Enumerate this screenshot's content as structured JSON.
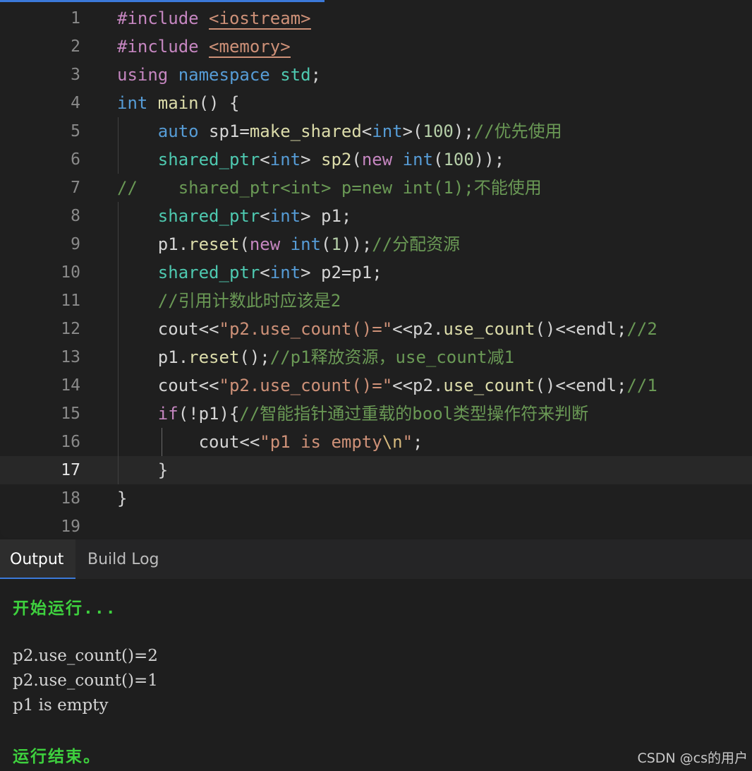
{
  "editor": {
    "active_line": "17",
    "lines": [
      {
        "n": "1",
        "tokens": [
          {
            "t": "#include ",
            "c": "pp"
          },
          {
            "t": "<iostream>",
            "c": "inc"
          }
        ]
      },
      {
        "n": "2",
        "tokens": [
          {
            "t": "#include ",
            "c": "pp"
          },
          {
            "t": "<memory>",
            "c": "inc"
          }
        ]
      },
      {
        "n": "3",
        "tokens": [
          {
            "t": "using ",
            "c": "ctl"
          },
          {
            "t": "namespace ",
            "c": "kw"
          },
          {
            "t": "std",
            "c": "ns"
          },
          {
            "t": ";",
            "c": ""
          }
        ]
      },
      {
        "n": "4",
        "tokens": [
          {
            "t": "int ",
            "c": "ty"
          },
          {
            "t": "main",
            "c": "fn"
          },
          {
            "t": "() {",
            "c": ""
          }
        ]
      },
      {
        "n": "5",
        "tokens": [
          {
            "t": "    ",
            "c": ""
          },
          {
            "t": "auto ",
            "c": "kw"
          },
          {
            "t": "sp1=",
            "c": ""
          },
          {
            "t": "make_shared",
            "c": "fn"
          },
          {
            "t": "<",
            "c": ""
          },
          {
            "t": "int",
            "c": "ty"
          },
          {
            "t": ">(",
            "c": ""
          },
          {
            "t": "100",
            "c": "num"
          },
          {
            "t": ");",
            "c": ""
          },
          {
            "t": "//优先使用",
            "c": "com"
          }
        ]
      },
      {
        "n": "6",
        "tokens": [
          {
            "t": "    ",
            "c": ""
          },
          {
            "t": "shared_ptr",
            "c": "ns"
          },
          {
            "t": "<",
            "c": ""
          },
          {
            "t": "int",
            "c": "ty"
          },
          {
            "t": "> ",
            "c": ""
          },
          {
            "t": "sp2",
            "c": "fn"
          },
          {
            "t": "(",
            "c": ""
          },
          {
            "t": "new ",
            "c": "ctl"
          },
          {
            "t": "int",
            "c": "ty"
          },
          {
            "t": "(",
            "c": ""
          },
          {
            "t": "100",
            "c": "num"
          },
          {
            "t": "));",
            "c": ""
          }
        ]
      },
      {
        "n": "7",
        "tokens": [
          {
            "t": "//    shared_ptr<int> p=new int(1);不能使用",
            "c": "com"
          }
        ]
      },
      {
        "n": "8",
        "tokens": [
          {
            "t": "    ",
            "c": ""
          },
          {
            "t": "shared_ptr",
            "c": "ns"
          },
          {
            "t": "<",
            "c": ""
          },
          {
            "t": "int",
            "c": "ty"
          },
          {
            "t": "> p1;",
            "c": ""
          }
        ]
      },
      {
        "n": "9",
        "tokens": [
          {
            "t": "    p1.",
            "c": ""
          },
          {
            "t": "reset",
            "c": "fn"
          },
          {
            "t": "(",
            "c": ""
          },
          {
            "t": "new ",
            "c": "ctl"
          },
          {
            "t": "int",
            "c": "ty"
          },
          {
            "t": "(",
            "c": ""
          },
          {
            "t": "1",
            "c": "num"
          },
          {
            "t": "));",
            "c": ""
          },
          {
            "t": "//分配资源",
            "c": "com"
          }
        ]
      },
      {
        "n": "10",
        "tokens": [
          {
            "t": "    ",
            "c": ""
          },
          {
            "t": "shared_ptr",
            "c": "ns"
          },
          {
            "t": "<",
            "c": ""
          },
          {
            "t": "int",
            "c": "ty"
          },
          {
            "t": "> p2=p1;",
            "c": ""
          }
        ]
      },
      {
        "n": "11",
        "tokens": [
          {
            "t": "    ",
            "c": ""
          },
          {
            "t": "//引用计数此时应该是2",
            "c": "com"
          }
        ]
      },
      {
        "n": "12",
        "tokens": [
          {
            "t": "    cout<<",
            "c": ""
          },
          {
            "t": "\"p2.use_count()=\"",
            "c": "str"
          },
          {
            "t": "<<p2.",
            "c": ""
          },
          {
            "t": "use_count",
            "c": "fn"
          },
          {
            "t": "()<<endl;",
            "c": ""
          },
          {
            "t": "//2",
            "c": "com"
          }
        ]
      },
      {
        "n": "13",
        "tokens": [
          {
            "t": "    p1.",
            "c": ""
          },
          {
            "t": "reset",
            "c": "fn"
          },
          {
            "t": "();",
            "c": ""
          },
          {
            "t": "//p1释放资源，use_count减1",
            "c": "com"
          }
        ]
      },
      {
        "n": "14",
        "tokens": [
          {
            "t": "    cout<<",
            "c": ""
          },
          {
            "t": "\"p2.use_count()=\"",
            "c": "str"
          },
          {
            "t": "<<p2.",
            "c": ""
          },
          {
            "t": "use_count",
            "c": "fn"
          },
          {
            "t": "()<<endl;",
            "c": ""
          },
          {
            "t": "//1",
            "c": "com"
          }
        ]
      },
      {
        "n": "15",
        "tokens": [
          {
            "t": "    ",
            "c": ""
          },
          {
            "t": "if",
            "c": "ctl"
          },
          {
            "t": "(!p1){",
            "c": ""
          },
          {
            "t": "//智能指针通过重载的bool类型操作符来判断",
            "c": "com"
          }
        ]
      },
      {
        "n": "16",
        "tokens": [
          {
            "t": "        cout<<",
            "c": ""
          },
          {
            "t": "\"p1 is empty",
            "c": "str"
          },
          {
            "t": "\\n",
            "c": "esc"
          },
          {
            "t": "\"",
            "c": "str"
          },
          {
            "t": ";",
            "c": ""
          }
        ]
      },
      {
        "n": "17",
        "tokens": [
          {
            "t": "    }",
            "c": ""
          }
        ]
      },
      {
        "n": "18",
        "tokens": [
          {
            "t": "}",
            "c": ""
          }
        ]
      },
      {
        "n": "19",
        "tokens": []
      }
    ]
  },
  "panel": {
    "tabs": [
      {
        "label": "Output",
        "selected": true
      },
      {
        "label": "Build Log",
        "selected": false
      }
    ],
    "output": {
      "start": "开始运行...",
      "lines": [
        "p2.use_count()=2",
        "p2.use_count()=1",
        "p1 is empty"
      ],
      "end": "运行结束。"
    }
  },
  "watermark": "CSDN @cs的用户"
}
